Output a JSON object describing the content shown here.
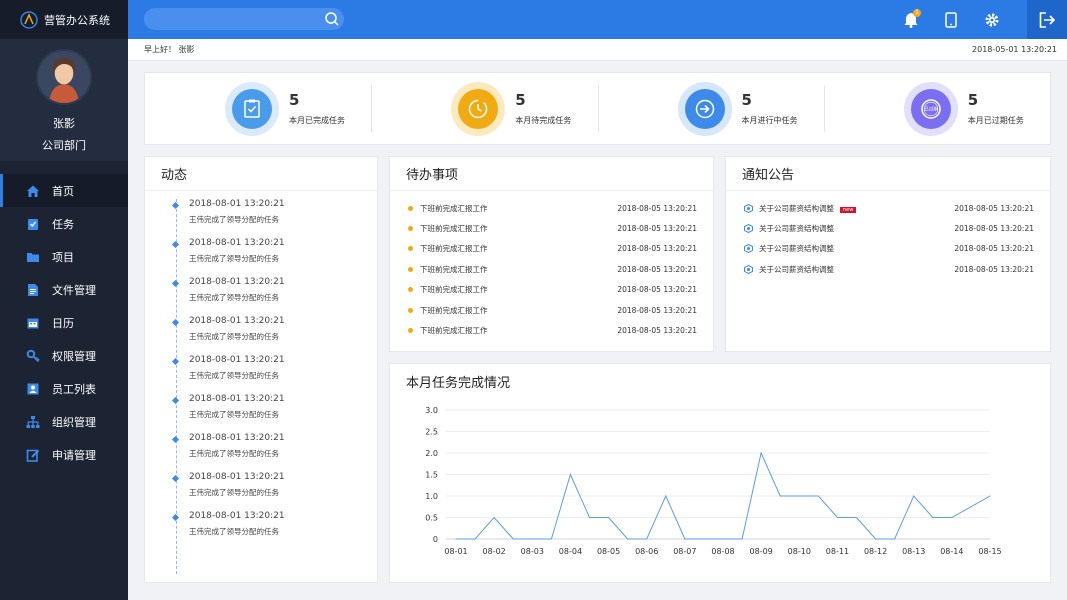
{
  "app": {
    "title": "营管办公系统"
  },
  "user": {
    "name": "张影",
    "dept": "公司部门"
  },
  "nav": [
    {
      "label": "首页",
      "icon": "home-icon",
      "active": true
    },
    {
      "label": "任务",
      "icon": "clipboard-icon"
    },
    {
      "label": "项目",
      "icon": "folder-icon"
    },
    {
      "label": "文件管理",
      "icon": "file-icon"
    },
    {
      "label": "日历",
      "icon": "calendar-icon"
    },
    {
      "label": "权限管理",
      "icon": "key-icon"
    },
    {
      "label": "员工列表",
      "icon": "contacts-icon"
    },
    {
      "label": "组织管理",
      "icon": "org-icon"
    },
    {
      "label": "申请管理",
      "icon": "edit-icon"
    }
  ],
  "header": {
    "notification_count": "1",
    "greeting": "早上好！ 张影",
    "datetime": "2018-05-01 13:20:21"
  },
  "stats": [
    {
      "value": "5",
      "label": "本月已完成任务",
      "color": "#4a9bea",
      "icon": "clipboard-check-icon"
    },
    {
      "value": "5",
      "label": "本月待完成任务",
      "color": "#f0ab14",
      "icon": "clock-icon"
    },
    {
      "value": "5",
      "label": "本月进行中任务",
      "color": "#3d8ae8",
      "icon": "arrow-right-icon"
    },
    {
      "value": "5",
      "label": "本月已过期任务",
      "color": "#7b6ef0",
      "icon": "expired-stamp-icon",
      "stamp_text": "已过期"
    }
  ],
  "dynamics": {
    "title": "动态",
    "items": [
      {
        "time": "2018-08-01  13:20:21",
        "text": "王伟完成了领导分配的任务"
      },
      {
        "time": "2018-08-01  13:20:21",
        "text": "王伟完成了领导分配的任务"
      },
      {
        "time": "2018-08-01  13:20:21",
        "text": "王伟完成了领导分配的任务"
      },
      {
        "time": "2018-08-01  13:20:21",
        "text": "王伟完成了领导分配的任务"
      },
      {
        "time": "2018-08-01  13:20:21",
        "text": "王伟完成了领导分配的任务"
      },
      {
        "time": "2018-08-01  13:20:21",
        "text": "王伟完成了领导分配的任务"
      },
      {
        "time": "2018-08-01  13:20:21",
        "text": "王伟完成了领导分配的任务"
      },
      {
        "time": "2018-08-01  13:20:21",
        "text": "王伟完成了领导分配的任务"
      },
      {
        "time": "2018-08-01  13:20:21",
        "text": "王伟完成了领导分配的任务"
      }
    ]
  },
  "todo": {
    "title": "待办事项",
    "items": [
      {
        "text": "下班前完成汇报工作",
        "time": "2018-08-05 13:20:21"
      },
      {
        "text": "下班前完成汇报工作",
        "time": "2018-08-05 13:20:21"
      },
      {
        "text": "下班前完成汇报工作",
        "time": "2018-08-05 13:20:21"
      },
      {
        "text": "下班前完成汇报工作",
        "time": "2018-08-05 13:20:21"
      },
      {
        "text": "下班前完成汇报工作",
        "time": "2018-08-05 13:20:21"
      },
      {
        "text": "下班前完成汇报工作",
        "time": "2018-08-05 13:20:21"
      },
      {
        "text": "下班前完成汇报工作",
        "time": "2018-08-05 13:20:21"
      }
    ]
  },
  "notices": {
    "title": "通知公告",
    "items": [
      {
        "text": "关于公司薪资结构调整",
        "time": "2018-08-05 13:20:21",
        "tag": "new"
      },
      {
        "text": "关于公司薪资结构调整",
        "time": "2018-08-05 13:20:21"
      },
      {
        "text": "关于公司薪资结构调整",
        "time": "2018-08-05 13:20:21"
      },
      {
        "text": "关于公司薪资结构调整",
        "time": "2018-08-05 13:20:21"
      }
    ]
  },
  "chart_data": {
    "type": "line",
    "title": "本月任务完成情况",
    "categories": [
      "08-01",
      "08-02",
      "08-03",
      "08-04",
      "08-05",
      "08-06",
      "08-07",
      "08-08",
      "08-09",
      "08-10",
      "08-11",
      "08-12",
      "08-13",
      "08-14",
      "08-15"
    ],
    "x": [
      "08-01",
      "",
      "08-02",
      "",
      "08-03",
      "",
      "08-04",
      "",
      "08-05",
      "",
      "08-06",
      "",
      "08-07",
      "",
      "08-08",
      "",
      "08-09",
      "",
      "08-10",
      "",
      "08-11",
      "",
      "08-12",
      "",
      "08-13",
      "",
      "08-14",
      "",
      "08-15"
    ],
    "values": [
      0,
      0,
      0.5,
      0,
      0,
      0,
      1.5,
      0.5,
      0.5,
      0,
      0,
      1.0,
      0,
      0,
      0,
      0,
      2.0,
      1.0,
      1.0,
      1.0,
      0.5,
      0.5,
      0,
      0,
      1.0,
      0.5,
      0.5,
      0.75,
      1.0
    ],
    "yticks": [
      "0",
      "0.5",
      "1.0",
      "1.5",
      "2.0",
      "2.5",
      "3.0"
    ],
    "ylim": [
      0,
      3
    ],
    "color": "#5b9ee6",
    "grid": true
  }
}
